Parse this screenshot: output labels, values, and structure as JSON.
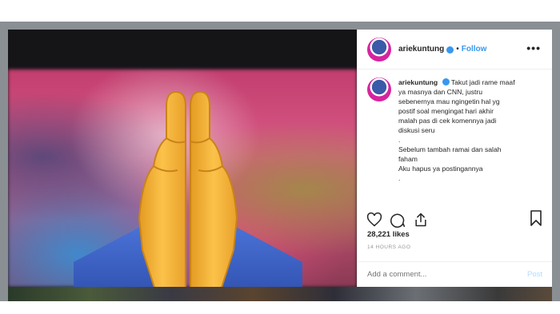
{
  "post": {
    "username": "ariekuntung",
    "follow_label": "Follow",
    "more_label": "•••",
    "dot": "•",
    "caption": {
      "username": "ariekuntung",
      "lines": [
        "Takut jadi rame maaf",
        "ya masnya dan CNN, justru",
        "sebenernya mau ngingetin hal yg",
        "postif soal mengingat hari akhir",
        "malah pas di cek komennya jadi",
        "diskusi seru",
        ".",
        "Sebelum tambah ramai dan salah",
        "faham",
        "Aku hapus ya postingannya",
        "."
      ]
    },
    "likes": "28,221 likes",
    "time_ago": "14 HOURS AGO",
    "comment_placeholder": "Add a comment...",
    "post_button": "Post"
  },
  "icons": {
    "like": "heart-icon",
    "comment": "comment-icon",
    "share": "share-icon",
    "save": "bookmark-icon",
    "verified": "verified-badge-icon",
    "image_emoji": "folded-hands-emoji"
  },
  "colors": {
    "follow_blue": "#3897f0",
    "post_disabled": "#b3dbff",
    "emoji_yellow": "#f7b53a",
    "sleeve_blue": "#3f63c8"
  }
}
